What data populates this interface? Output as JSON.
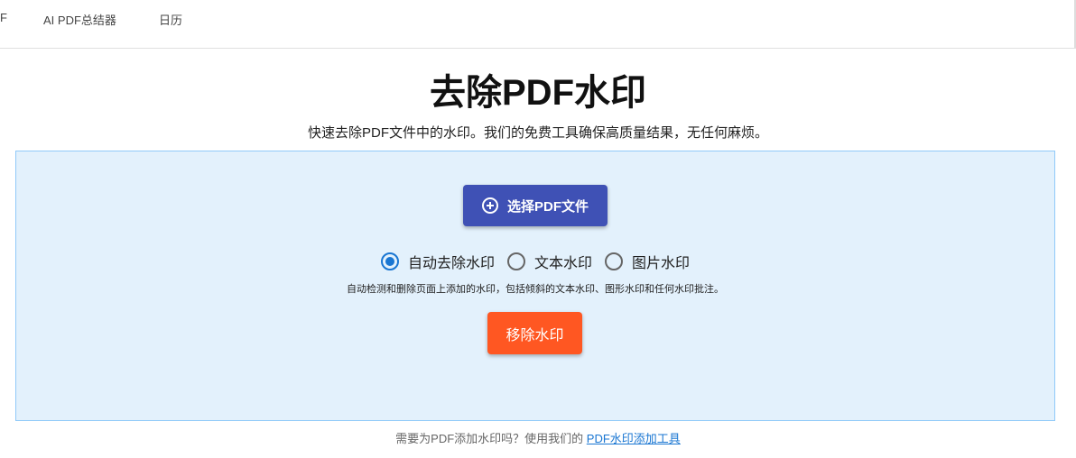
{
  "nav": {
    "items": [
      "F",
      "AI PDF总结器",
      "日历"
    ]
  },
  "title": "去除PDF水印",
  "subtitle": "快速去除PDF文件中的水印。我们的免费工具确保高质量结果，无任何麻烦。",
  "select_button": "选择PDF文件",
  "options": [
    {
      "label": "自动去除水印",
      "selected": true
    },
    {
      "label": "文本水印",
      "selected": false
    },
    {
      "label": "图片水印",
      "selected": false
    }
  ],
  "hint": "自动检测和删除页面上添加的水印，包括倾斜的文本水印、图形水印和任何水印批注。",
  "remove_button": "移除水印",
  "footer": {
    "text": "需要为PDF添加水印吗？使用我们的 ",
    "link": "PDF水印添加工具"
  }
}
